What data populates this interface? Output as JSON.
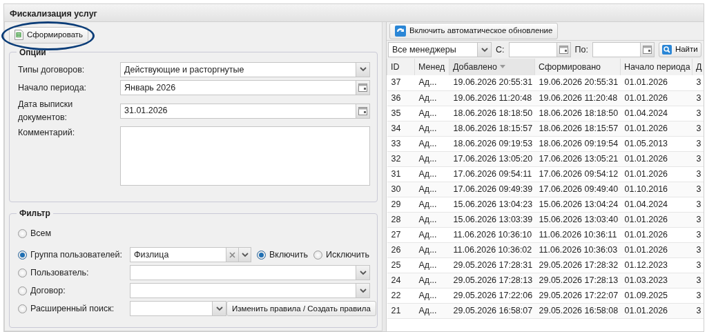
{
  "window": {
    "title": "Фискализация услуг"
  },
  "generate_button": {
    "label": "Сформировать",
    "highlighted": true
  },
  "options": {
    "legend": "Опции",
    "fields": [
      {
        "kind": "select",
        "label": "Типы договоров:",
        "value": "Действующие и расторгнутые"
      },
      {
        "kind": "date",
        "label": "Начало периода:",
        "value": "Январь 2026"
      },
      {
        "kind": "date",
        "label": "Дата выписки документов:",
        "value": "31.01.2026"
      },
      {
        "kind": "textarea",
        "label": "Комментарий:"
      }
    ]
  },
  "filter": {
    "legend": "Фильтр",
    "rows": [
      {
        "kind": "plain",
        "label": "Всем",
        "selected": false
      },
      {
        "kind": "group",
        "label": "Группа пользователей:",
        "selected": true,
        "value": "Физлица",
        "modes": [
          {
            "label": "Включить",
            "selected": true
          },
          {
            "label": "Исключить",
            "selected": false
          }
        ]
      },
      {
        "kind": "select",
        "label": "Пользователь:",
        "selected": false
      },
      {
        "kind": "select",
        "label": "Договор:",
        "selected": false
      },
      {
        "kind": "search",
        "label": "Расширенный поиск:",
        "selected": false,
        "button": "Изменить правила / Создать правила"
      }
    ]
  },
  "right": {
    "refresh_button": "Включить автоматическое обновление",
    "manager_select": "Все менеджеры",
    "from_label": "С:",
    "to_label": "По:",
    "find_button": "Найти",
    "table": {
      "columns": [
        {
          "label": "ID",
          "sorted": false
        },
        {
          "label": "Менед",
          "sorted": false
        },
        {
          "label": "Добавлено",
          "sorted": true
        },
        {
          "label": "Сформировано",
          "sorted": false
        },
        {
          "label": "Начало периода",
          "sorted": false
        },
        {
          "label": "Д",
          "sorted": false
        }
      ],
      "rows": [
        [
          "37",
          "Ад...",
          "19.06.2026 20:55:31",
          "19.06.2026 20:55:31",
          "01.01.2026",
          "3"
        ],
        [
          "36",
          "Ад...",
          "19.06.2026 11:20:48",
          "19.06.2026 11:20:48",
          "01.01.2026",
          "3"
        ],
        [
          "35",
          "Ад...",
          "18.06.2026 18:18:50",
          "18.06.2026 18:18:50",
          "01.04.2024",
          "3"
        ],
        [
          "34",
          "Ад...",
          "18.06.2026 18:15:57",
          "18.06.2026 18:15:57",
          "01.01.2026",
          "3"
        ],
        [
          "33",
          "Ад...",
          "18.06.2026 09:19:53",
          "18.06.2026 09:19:54",
          "01.05.2013",
          "3"
        ],
        [
          "32",
          "Ад...",
          "17.06.2026 13:05:20",
          "17.06.2026 13:05:21",
          "01.01.2026",
          "3"
        ],
        [
          "31",
          "Ад...",
          "17.06.2026 09:54:11",
          "17.06.2026 09:54:12",
          "01.01.2026",
          "3"
        ],
        [
          "30",
          "Ад...",
          "17.06.2026 09:49:39",
          "17.06.2026 09:49:40",
          "01.10.2016",
          "3"
        ],
        [
          "29",
          "Ад...",
          "15.06.2026 13:04:23",
          "15.06.2026 13:04:24",
          "01.04.2024",
          "3"
        ],
        [
          "28",
          "Ад...",
          "15.06.2026 13:03:39",
          "15.06.2026 13:03:40",
          "01.01.2026",
          "3"
        ],
        [
          "27",
          "Ад...",
          "11.06.2026 10:36:10",
          "11.06.2026 10:36:11",
          "01.01.2026",
          "3"
        ],
        [
          "26",
          "Ад...",
          "11.06.2026 10:36:02",
          "11.06.2026 10:36:03",
          "01.01.2026",
          "3"
        ],
        [
          "25",
          "Ад...",
          "29.05.2026 17:28:31",
          "29.05.2026 17:28:32",
          "01.12.2023",
          "3"
        ],
        [
          "24",
          "Ад...",
          "29.05.2026 17:28:13",
          "29.05.2026 17:28:13",
          "01.03.2023",
          "3"
        ],
        [
          "22",
          "Ад...",
          "29.05.2026 17:22:06",
          "29.05.2026 17:22:07",
          "01.09.2025",
          "3"
        ],
        [
          "21",
          "Ад...",
          "29.05.2026 16:58:07",
          "29.05.2026 16:58:08",
          "01.01.2026",
          "3"
        ]
      ]
    }
  }
}
